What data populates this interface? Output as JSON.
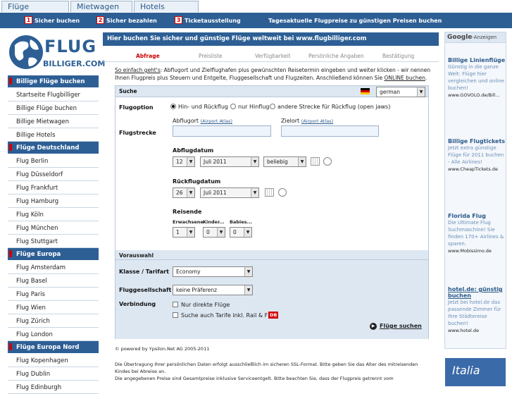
{
  "tabs": [
    "Flüge",
    "Mietwagen",
    "Hotels"
  ],
  "bar": [
    {
      "num": "1",
      "text": "Sicher buchen"
    },
    {
      "num": "2",
      "text": "Sicher bezahlen"
    },
    {
      "num": "3",
      "text": "Ticketausstellung"
    },
    {
      "text": "Tagesaktuelle Flugpreise zu günstigen Preisen buchen"
    }
  ],
  "logo": {
    "line1": "FLUG",
    "line2": "BILLIGER.COM"
  },
  "sidebar": [
    {
      "type": "head",
      "label": "Billige Flüge buchen"
    },
    {
      "type": "item",
      "label": "Startseite Flugbilliger"
    },
    {
      "type": "item",
      "label": "Billige Flüge buchen"
    },
    {
      "type": "item",
      "label": "Billige Mietwagen"
    },
    {
      "type": "item",
      "label": "Billige Hotels"
    },
    {
      "type": "head",
      "label": "Flüge Deutschland"
    },
    {
      "type": "item",
      "label": "Flug Berlin"
    },
    {
      "type": "item",
      "label": "Flug Düsseldorf"
    },
    {
      "type": "item",
      "label": "Flug Frankfurt"
    },
    {
      "type": "item",
      "label": "Flug Hamburg"
    },
    {
      "type": "item",
      "label": "Flug Köln"
    },
    {
      "type": "item",
      "label": "Flug München"
    },
    {
      "type": "item",
      "label": "Flug Stuttgart"
    },
    {
      "type": "head",
      "label": "Flüge Europa"
    },
    {
      "type": "item",
      "label": "Flug Amsterdam"
    },
    {
      "type": "item",
      "label": "Flug Basel"
    },
    {
      "type": "item",
      "label": "Flug Paris"
    },
    {
      "type": "item",
      "label": "Flug Wien"
    },
    {
      "type": "item",
      "label": "Flug Zürich"
    },
    {
      "type": "item",
      "label": "Flug London"
    },
    {
      "type": "head",
      "label": "Flüge Europa Nord"
    },
    {
      "type": "item",
      "label": "Flug Kopenhagen"
    },
    {
      "type": "item",
      "label": "Flug Dublin"
    },
    {
      "type": "item",
      "label": "Flug Edinburgh"
    }
  ],
  "main": {
    "title": "Hier buchen Sie sicher und günstige Flüge weltweit bei www.flugbilliger.com",
    "steps": [
      "Abfrage",
      "Preisliste",
      "Verfügbarkeit",
      "Persönliche Angaben",
      "Bestätigung"
    ],
    "intro_lead": "So einfach geht's",
    "intro_text": ": Abflugort und Zielflughafen plus gewünschten Reisetermin eingeben und weiter klicken - wir nennen Ihnen Flugpreis plus Steuern und Entgelte, Fluggesellschaft und Flugzeiten. Anschließend können Sie ",
    "intro_link": "ONLINE buchen",
    "intro_end": "."
  },
  "form": {
    "section": "Suche",
    "language": "german",
    "flugoption_label": "Flugoption",
    "options": [
      "Hin- und Rückflug",
      "nur Hinflug",
      "andere Strecke für Rückflug (open jaws)"
    ],
    "abflugort_label": "Abflugort",
    "zielort_label": "Zielort",
    "atlas_label": "(Airport Atlas)",
    "flugstrecke_label": "Flugstrecke",
    "abflugdatum_label": "Abflugdatum",
    "abflug_day": "12",
    "abflug_month": "Juli 2011",
    "abflug_time": "beliebig",
    "rueckflug_label": "Rückflugdatum",
    "rueck_day": "26",
    "rueck_month": "Juli 2011",
    "reisende_label": "Reisende",
    "pax": [
      {
        "label": "Erwachsene",
        "value": "1"
      },
      {
        "label": "Kinder...",
        "value": "0"
      },
      {
        "label": "Babies...",
        "value": "0"
      }
    ],
    "vorauswahl": "Vorauswahl",
    "klasse_label": "Klasse / Tarifart",
    "klasse_value": "Economy",
    "airline_label": "Fluggesellschaft",
    "airline_value": "keine Präferenz",
    "verbindung_label": "Verbindung",
    "chk1": "Nur direkte Flüge",
    "chk2": "Suche auch Tarife inkl. Rail & Fly",
    "db": "DB",
    "submit": "Flüge suchen"
  },
  "footer": {
    "powered": "© powered by Ypsilon.Net AG 2005-2011",
    "p1": "Die Übertragung Ihrer persönlichen Daten erfolgt ausschließlich im sicheren SSL-Format. Bitte geben Sie das Alter des mitreisenden Kindes bei Abreise an.",
    "p2": "Die angegebenen Preise sind Gesamtpreise inklusive Serviceentgelt. Bitte beachten Sie, dass der Flugpreis getrennt vom"
  },
  "ads": {
    "brand": "Google",
    "tag": "-Anzeigen",
    "items": [
      {
        "title": "Billige Linienflüge",
        "desc": "Günstig in die ganze Welt: Flüge hier vergleichen und online buchen!",
        "url": "www.GOVOLO.de/Bill..."
      },
      {
        "title": "Billige Flugtickets",
        "desc": "Jetzt extra günstige Flüge für 2011 buchen - Alle Airlines!",
        "url": "www.CheapTickets.de"
      },
      {
        "title": "Florida Flug",
        "desc": "Die Ultimate Flug Suchmaschine! Sie finden 170+ Airlines & sparen.",
        "url": "www.Mobissimo.de"
      },
      {
        "title": "hotel.de: günstig buchen",
        "desc": "Jetzt bei hotel.de das passende Zimmer für Ihre Städtereise buchen!",
        "url": "www.hotel.de"
      }
    ],
    "banner": "Italia"
  },
  "colors": {
    "primary": "#2d5f95",
    "accent": "#d10000",
    "link": "#2a5a8a"
  }
}
